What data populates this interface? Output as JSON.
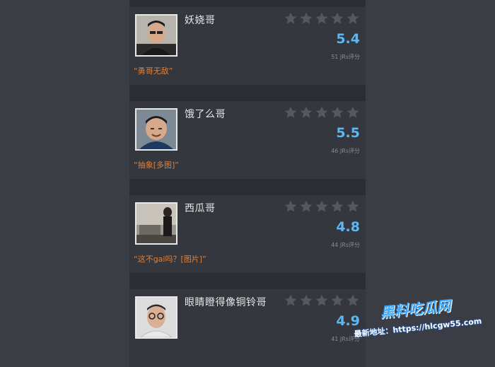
{
  "cards": [
    {
      "name": "妖娆哥",
      "score": "5.4",
      "count": "51 JRs评分",
      "quote": "“勇哥无敌”"
    },
    {
      "name": "饿了么哥",
      "score": "5.5",
      "count": "46 JRs评分",
      "quote": "“抽象[多图]”"
    },
    {
      "name": "西瓜哥",
      "score": "4.8",
      "count": "44 JRs评分",
      "quote": "“这不gai吗？[图片]”"
    },
    {
      "name": "眼睛瞪得像铜铃哥",
      "score": "4.9",
      "count": "41 JRs评分",
      "quote": ""
    }
  ],
  "watermark": {
    "logo": "黑料吃瓜网",
    "line": "最新地址：https://hlcgw55.com"
  },
  "colors": {
    "score": "#5bb8f0",
    "quote": "#e0803a",
    "star_empty": "#55585e"
  },
  "icons": {
    "star": "star-icon"
  }
}
